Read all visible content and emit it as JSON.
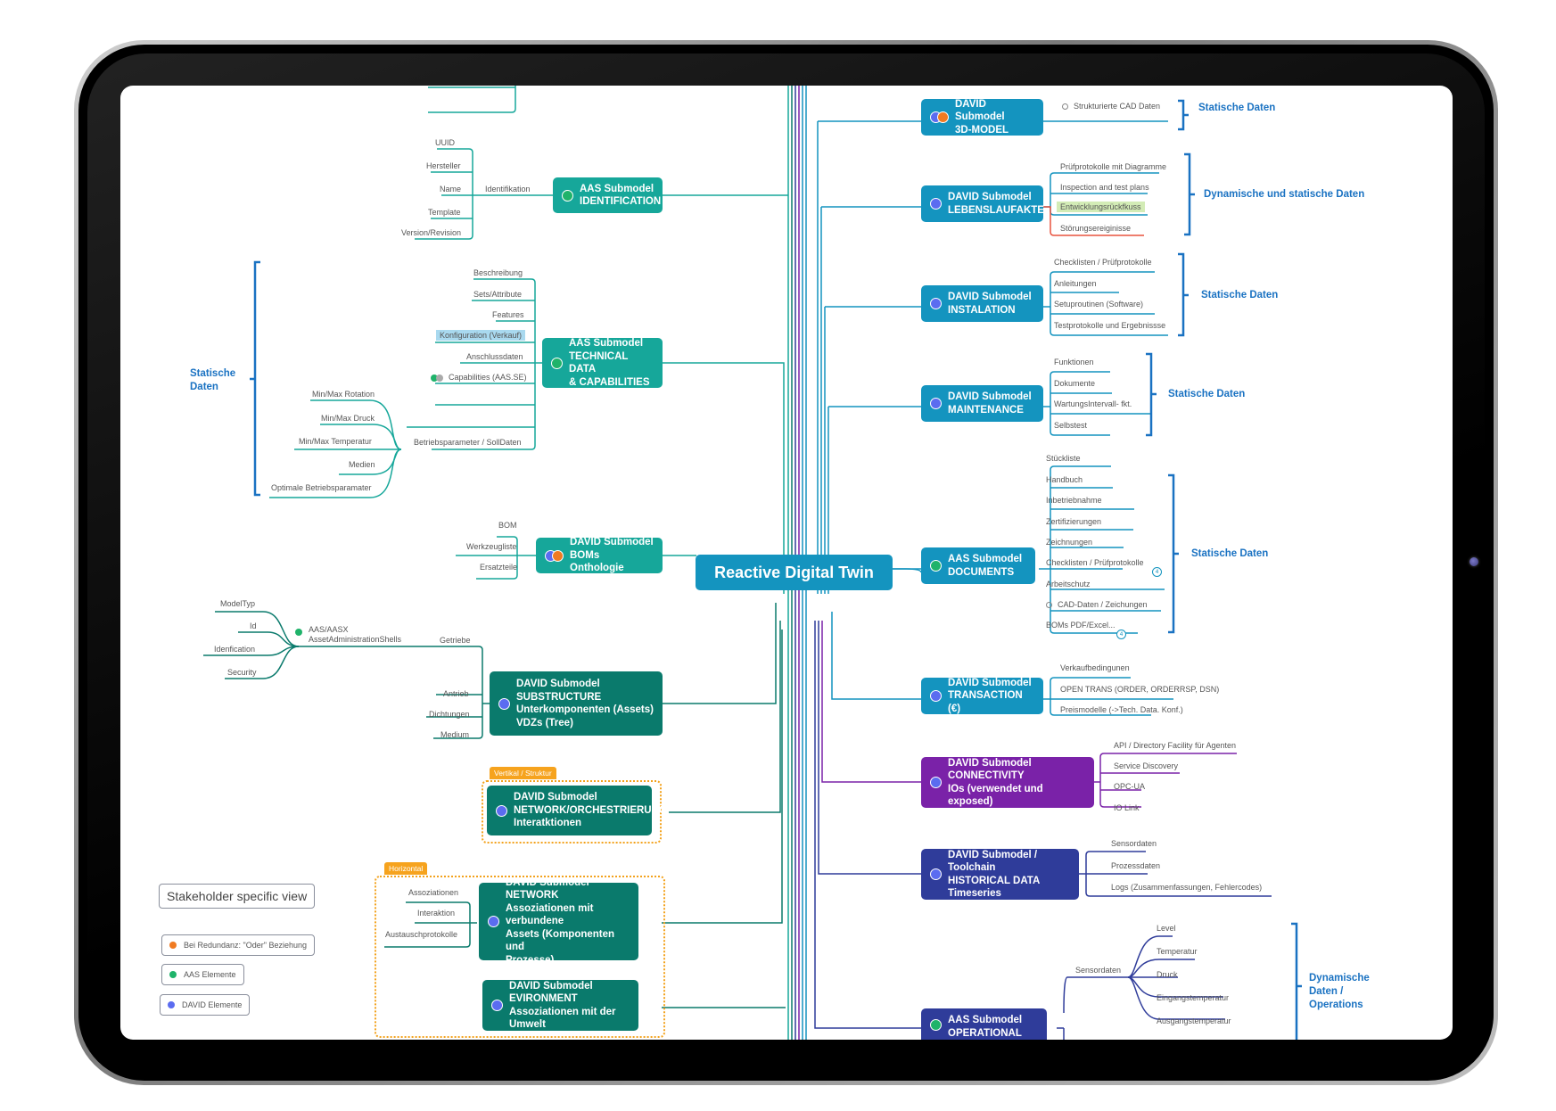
{
  "center": {
    "title": "Reactive Digital Twin"
  },
  "left": {
    "top_partial": {},
    "identification": {
      "title_line1": "AAS Submodel",
      "title_line2": "IDENTIFICATION",
      "marker": "aas",
      "branch": "Identifikation",
      "items": [
        "UUID",
        "Hersteller",
        "Name",
        "Template",
        "Version/Revision"
      ]
    },
    "technical": {
      "title_line1": "AAS Submodel",
      "title_line2": "TECHNICAL DATA",
      "title_line3": "& CAPABILITIES",
      "marker": "aas",
      "items": [
        "Beschreibung",
        "Sets/Attribute",
        "Features",
        "Konfiguration (Verkauf)",
        "Anschlussdaten",
        "Capabilities (AAS.SE)",
        "Betriebsparameter / SollDaten"
      ],
      "betrieb_items": [
        "Min/Max Rotation",
        "Min/Max Druck",
        "Min/Max Temperatur",
        "Medien",
        "Optimale Betriebsparamater"
      ],
      "brace_label_line1": "Statische",
      "brace_label_line2": "Daten"
    },
    "boms": {
      "title_line1": "DAVID Submodel",
      "title_line2": "BOMs Onthologie",
      "marker": "david-redundant",
      "items": [
        "BOM",
        "Werkzeugliste",
        "Ersatzteile"
      ]
    },
    "substructure": {
      "title_line1": "DAVID Submodel",
      "title_line2": "SUBSTRUCTURE",
      "title_line3": "Unterkomponenten (Assets)",
      "title_line4": "VDZs (Tree)",
      "marker": "david",
      "items": [
        "Getriebe",
        "Antrieb",
        "Dichtungen",
        "Medium"
      ],
      "aas_label_line1": "AAS/AASX",
      "aas_label_line2": "AssetAdministrationShells",
      "aas_items": [
        "ModelTyp",
        "Id",
        "Idenfication",
        "Security"
      ]
    },
    "orchestrierung": {
      "group_tag": "Vertikal / Struktur",
      "title_line1": "DAVID Submodel",
      "title_line2": "NETWORK/ORCHESTRIERUNG",
      "title_line3": "Interatktionen",
      "marker": "david"
    },
    "network": {
      "group_tag": "Horizontal",
      "title_line1": "DAVID Submodel",
      "title_line2": "NETWORK",
      "title_line3": "Assoziationen mit verbundene",
      "title_line4": "Assets (Komponenten und",
      "title_line5": "Prozesse)",
      "marker": "david",
      "items": [
        "Assoziationen",
        "Interaktion",
        "Austauschprotokolle"
      ]
    },
    "environment": {
      "title_line1": "DAVID Submodel",
      "title_line2": "EVIRONMENT",
      "title_line3": "Assoziationen mit der Umwelt",
      "marker": "david"
    }
  },
  "legend": {
    "title": "Stakeholder specific view",
    "items": [
      {
        "label": "Bei Redundanz: \"Oder\" Beziehung",
        "color": "#f07b22"
      },
      {
        "label": "AAS Elemente",
        "color": "#1fb36a"
      },
      {
        "label": "DAVID Elemente",
        "color": "#5b6cf0"
      }
    ]
  },
  "right": {
    "model3d": {
      "title_line1": "DAVID Submodel",
      "title_line2": "3D-MODEL",
      "marker": "david-redundant",
      "items": [
        "Strukturierte CAD Daten"
      ],
      "brace_label": "Statische Daten"
    },
    "lebenslauf": {
      "title_line1": "DAVID Submodel",
      "title_line2": "LEBENSLAUFAKTE",
      "marker": "david",
      "items": [
        "Prüfprotokolle mit Diagramme",
        "Inspection and test plans",
        "Entwicklungsrückfkuss",
        "Störungsereiginisse"
      ],
      "brace_label": "Dynamische und statische Daten"
    },
    "installation": {
      "title_line1": "DAVID Submodel",
      "title_line2": "INSTALATION",
      "marker": "david",
      "items": [
        "Checklisten / Prüfprotokolle",
        "Anleitungen",
        "Setuproutinen (Software)",
        "Testprotokolle und Ergebnissse"
      ],
      "brace_label": "Statische Daten"
    },
    "maintenance": {
      "title_line1": "DAVID Submodel",
      "title_line2": "MAINTENANCE",
      "marker": "david",
      "items": [
        "Funktionen",
        "Dokumente",
        "WartungsIntervall- fkt.",
        "Selbstest"
      ],
      "brace_label": "Statische Daten"
    },
    "documents": {
      "title_line1": "AAS Submodel",
      "title_line2": "DOCUMENTS",
      "marker": "aas",
      "items": [
        "Stückliste",
        "Handbuch",
        "Inbetriebnahme",
        "Zertifizierungen",
        "Zeichnungen",
        "Checklisten / Prüfprotokolle",
        "Arbeitschutz",
        "CAD-Daten / Zeichungen",
        "BOMs PDF/Excel..."
      ],
      "collapsed_counts": [
        "4",
        "4"
      ],
      "brace_label": "Statische Daten"
    },
    "transaction": {
      "title_line1": "DAVID Submodel",
      "title_line2": "TRANSACTION (€)",
      "marker": "david",
      "items": [
        "Verkaufbedingunen",
        "OPEN TRANS (ORDER, ORDERRSP, DSN)",
        "Preismodelle (->Tech. Data. Konf.)"
      ]
    },
    "connectivity": {
      "title_line1": "DAVID Submodel",
      "title_line2": "CONNECTIVITY",
      "title_line3": "IOs (verwendet und exposed)",
      "marker": "david",
      "items": [
        "API / Directory Facility für Agenten",
        "Service Discovery",
        "OPC-UA",
        "IO Link"
      ]
    },
    "historical": {
      "title_line1": "DAVID Submodel / Toolchain",
      "title_line2": "HISTORICAL DATA",
      "title_line3": "Timeseries",
      "marker": "david",
      "items": [
        "Sensordaten",
        "Prozessdaten",
        "Logs (Zusammenfassungen, Fehlercodes)"
      ]
    },
    "operational": {
      "title_line1": "AAS Submodel",
      "title_line2": "OPERATIONAL DATA",
      "marker": "aas",
      "branch": "Sensordaten",
      "items": [
        "Level",
        "Temperatur",
        "Druck",
        "Eingangstemperatur",
        "Ausgangstemperatur"
      ],
      "brace_label_line1": "Dynamische",
      "brace_label_line2": "Daten /",
      "brace_label_line3": "Operations"
    }
  },
  "colors": {
    "aas_green": "#1fb36a",
    "david_blue": "#5b6cf0",
    "redundancy_orange": "#f07b22",
    "teal": "#16a79a",
    "dark_teal": "#0a7a6c",
    "cyan": "#1494bf",
    "purple": "#7a22a8",
    "indigo": "#2f3c9a",
    "brace_blue": "#1a72c2",
    "group_orange": "#f3a21c"
  }
}
